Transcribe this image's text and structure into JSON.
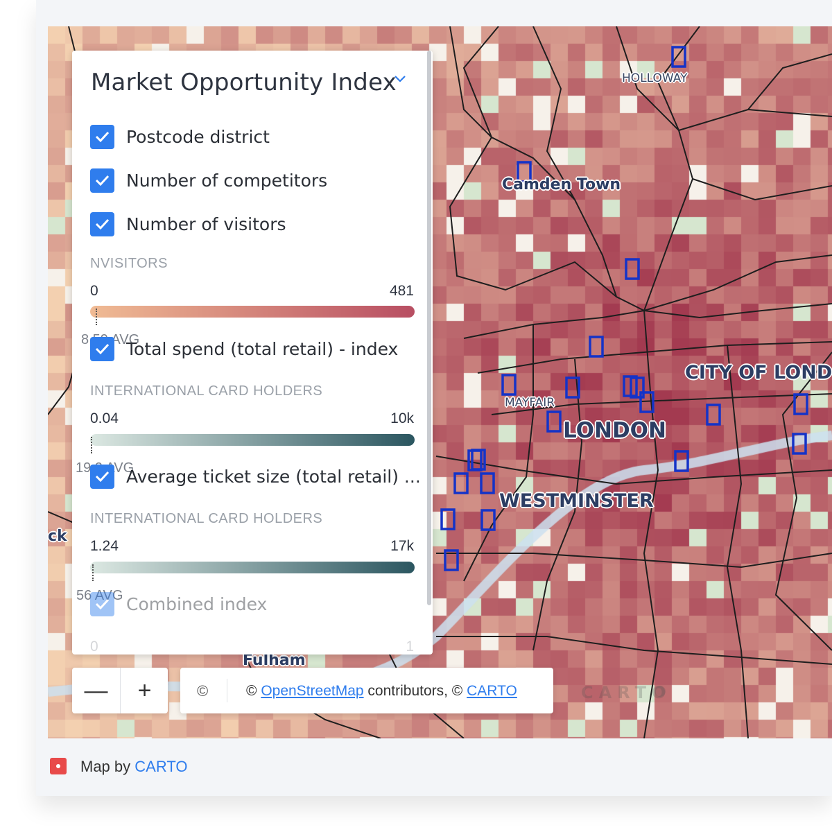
{
  "legend": {
    "title": "Market Opportunity Index",
    "layers": [
      {
        "label": "Postcode district",
        "checked": true
      },
      {
        "label": "Number of competitors",
        "checked": true
      },
      {
        "label": "Number of visitors",
        "checked": true
      },
      {
        "label": "Total spend (total retail) - index",
        "checked": true
      },
      {
        "label": "Average ticket size (total retail) ...",
        "checked": true
      },
      {
        "label": "Combined index",
        "checked": true
      }
    ],
    "scales": [
      {
        "name": "NVISITORS",
        "min": "0",
        "max": "481",
        "avg": "8.59 AVG",
        "from": "#f0bb94",
        "to": "#b84e62"
      },
      {
        "name": "INTERNATIONAL CARD HOLDERS",
        "min": "0.04",
        "max": "10k",
        "avg": "19.2 AVG",
        "from": "#dce8e2",
        "to": "#2b5660"
      },
      {
        "name": "INTERNATIONAL CARD HOLDERS",
        "min": "1.24",
        "max": "17k",
        "avg": "56 AVG",
        "from": "#dce8e2",
        "to": "#2b5660"
      },
      {
        "min": "0",
        "max": "1"
      }
    ]
  },
  "map": {
    "places": [
      {
        "name": "HOLLOWAY"
      },
      {
        "name": "Camden Town"
      },
      {
        "name": "CITY OF LOND"
      },
      {
        "name": "MAYFAIR"
      },
      {
        "name": "LONDON"
      },
      {
        "name": "WESTMINSTER"
      },
      {
        "name": "Fulham"
      },
      {
        "name": "ck"
      }
    ],
    "colors": {
      "low": "#f3d0b0",
      "high": "#a33a50",
      "park": "#d6e6cf",
      "competitor": "#1433c8"
    }
  },
  "zoom": {
    "minus": "—",
    "plus": "+"
  },
  "attribution": {
    "symbol": "©",
    "prefix": "© ",
    "osm": "OpenStreetMap",
    "middle": " contributors, © ",
    "carto": "CARTO"
  },
  "watermark": "CARTO",
  "footer": {
    "prefix": "Map by ",
    "link": "CARTO"
  }
}
